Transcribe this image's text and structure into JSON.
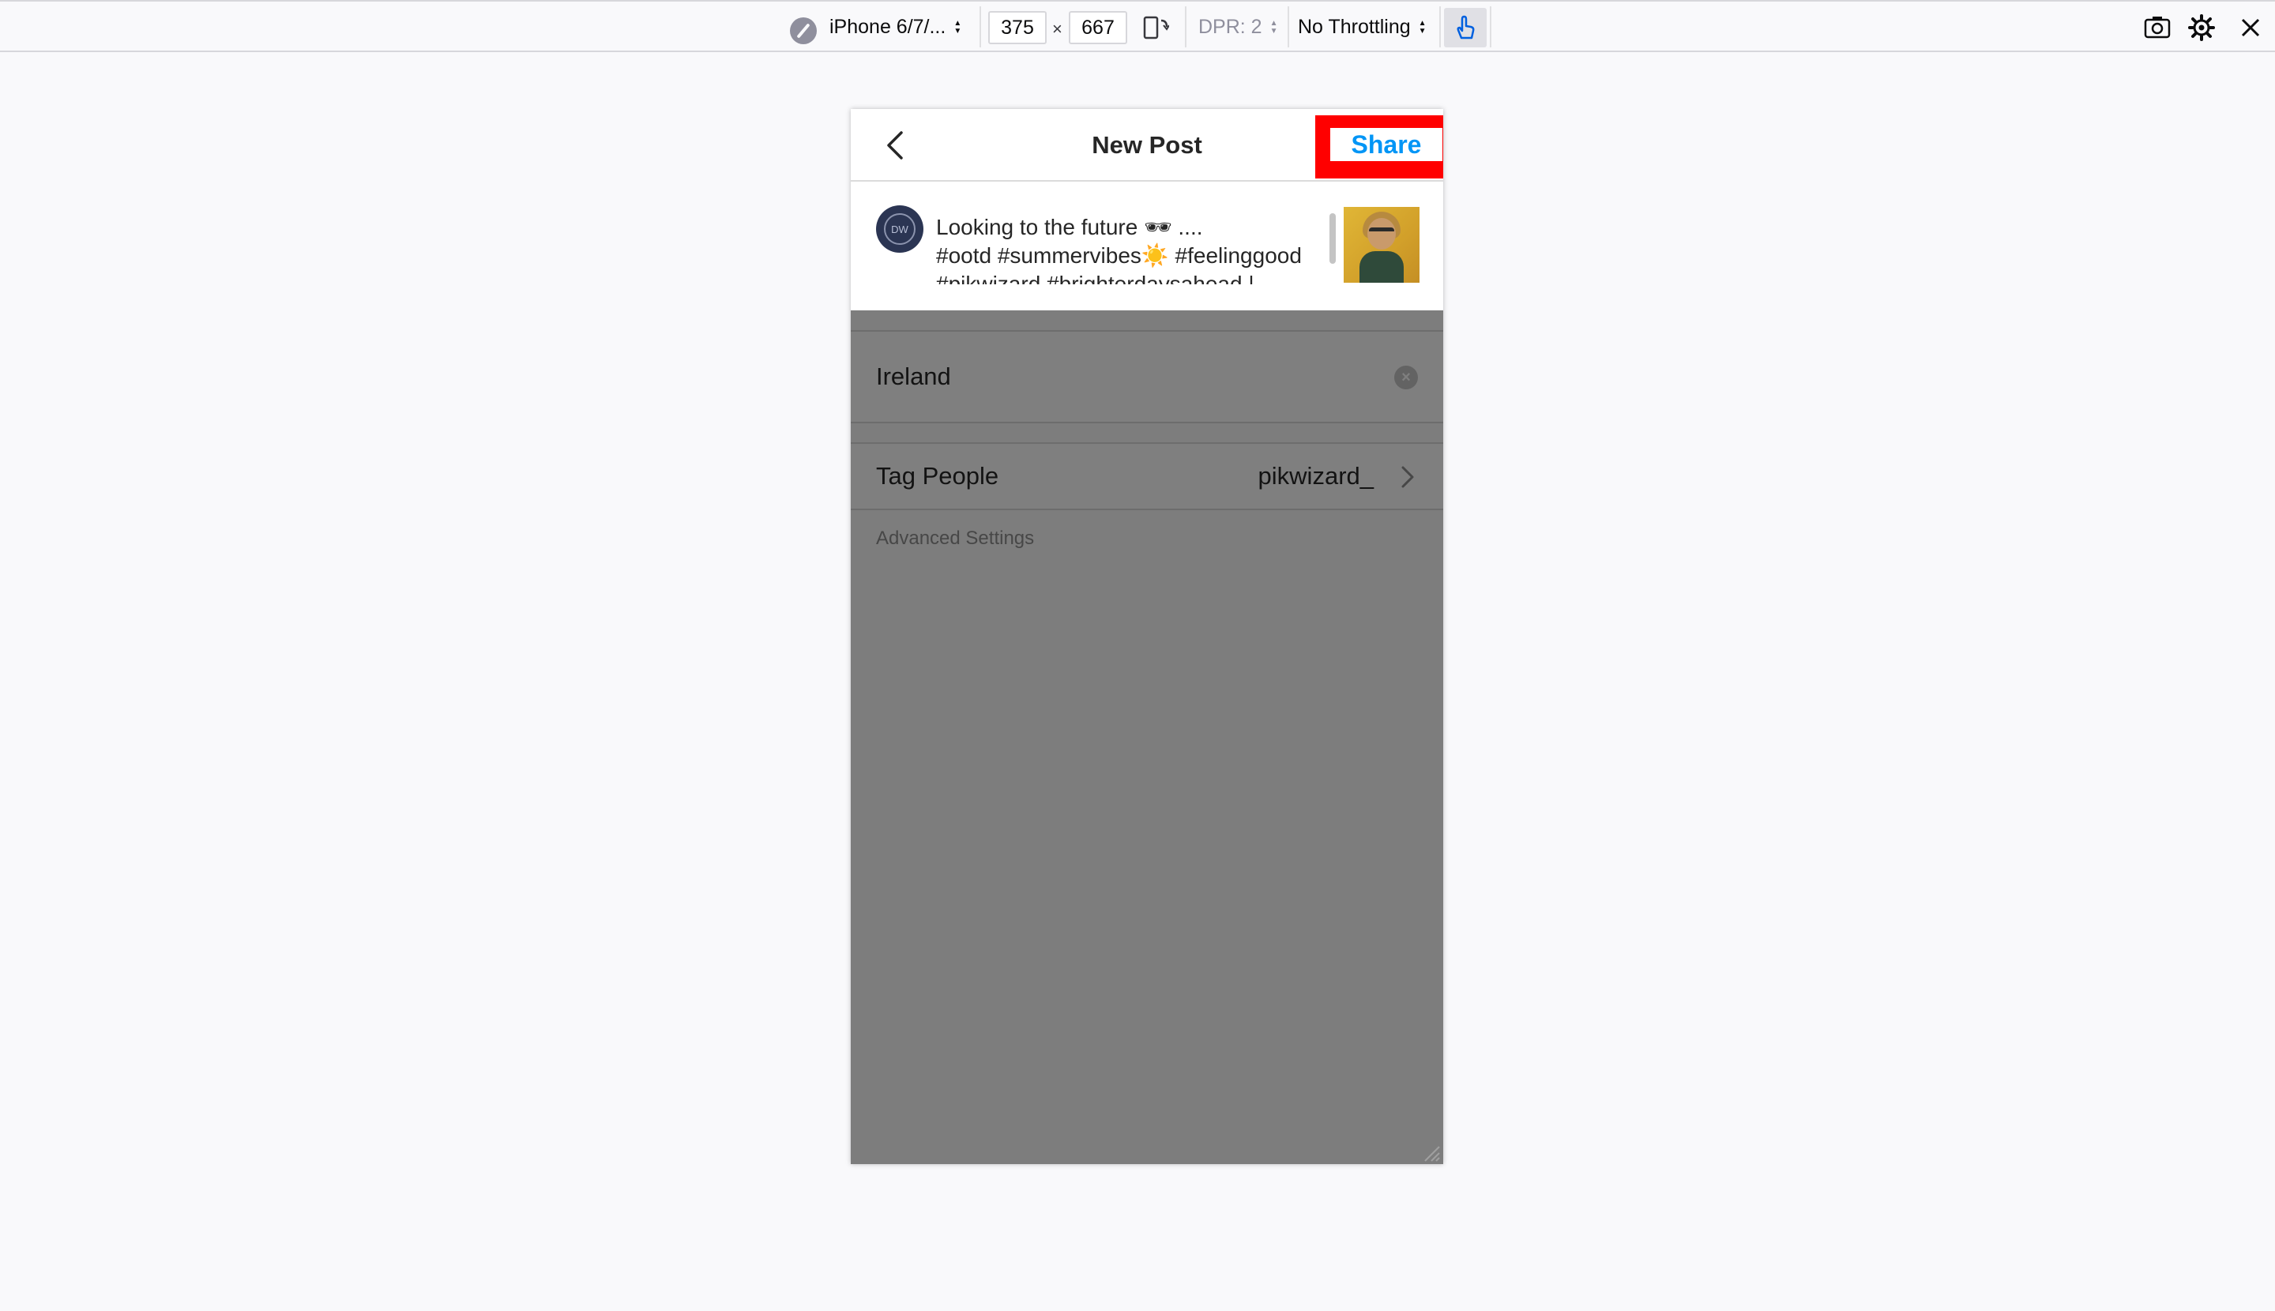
{
  "toolbar": {
    "device_name": "iPhone 6/7/...",
    "width": "375",
    "times": "×",
    "height": "667",
    "dpr": "DPR: 2",
    "throttling": "No Throttling"
  },
  "header": {
    "title": "New Post",
    "share_label": "Share"
  },
  "caption": {
    "avatar_initials": "DW",
    "text": "Looking to the future 🕶 ....\n#ootd #summervibes☀️ #feelinggood\n#pikwizard #brighterdaysahead |"
  },
  "location": {
    "value": "Ireland"
  },
  "tag_people": {
    "label": "Tag People",
    "value": "pikwizard_"
  },
  "advanced_settings": "Advanced Settings",
  "colors": {
    "accent_blue": "#0095f6",
    "highlight_red": "#ff0000"
  },
  "icons": [
    "device-icon",
    "rotate-icon",
    "touch-icon",
    "screenshot-icon",
    "settings-icon",
    "close-icon",
    "back-chevron-icon",
    "clear-icon",
    "chevron-right-icon"
  ]
}
